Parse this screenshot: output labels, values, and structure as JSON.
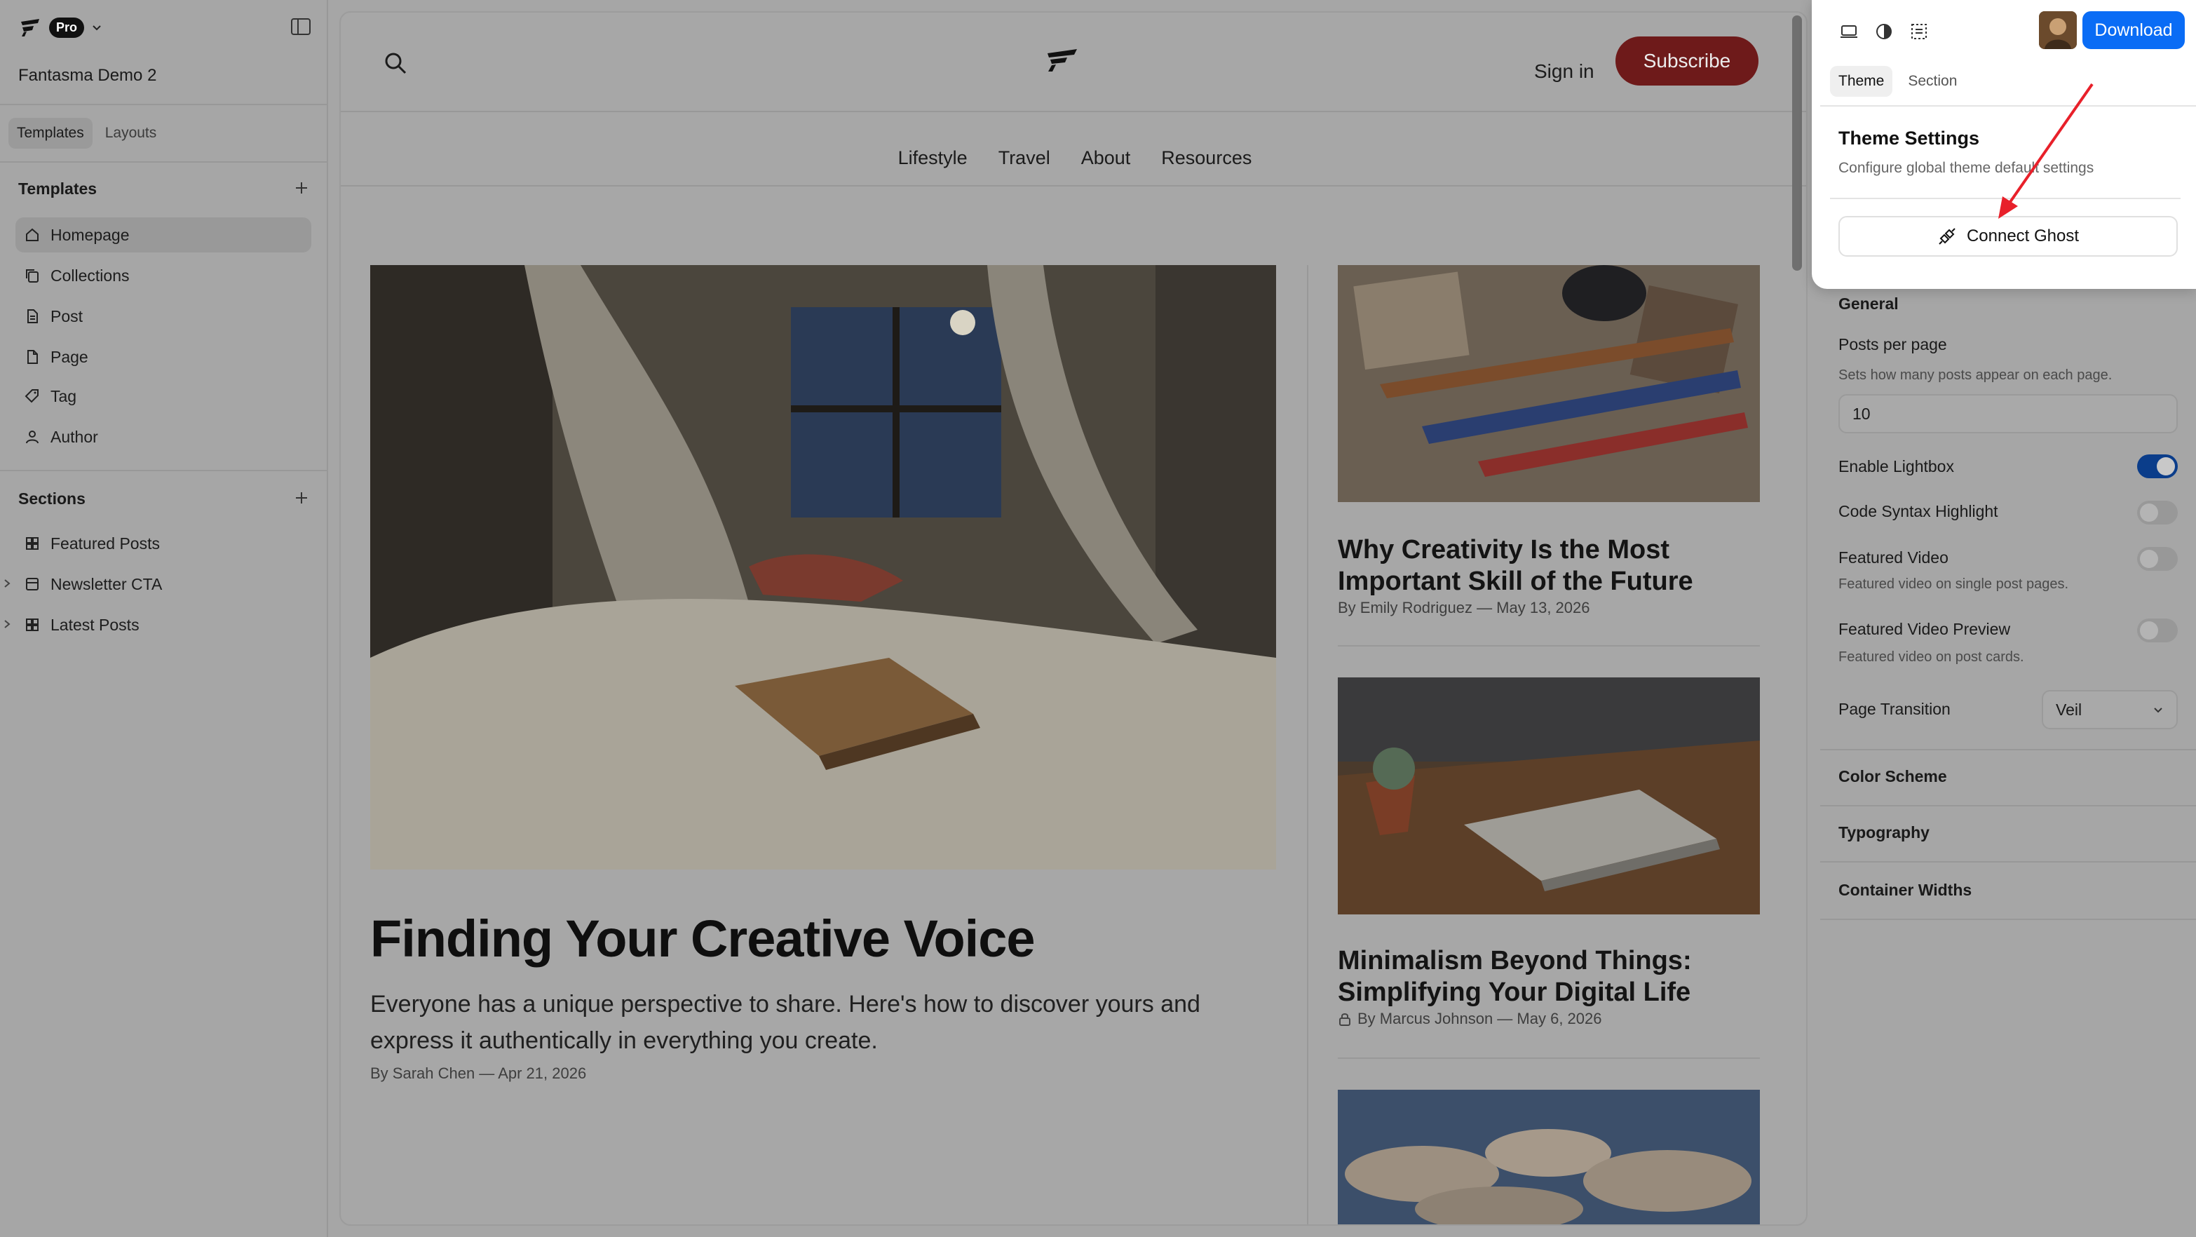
{
  "app": {
    "plan_badge": "Pro",
    "project_name": "Fantasma Demo 2",
    "mode_tabs": [
      "Templates",
      "Layouts"
    ],
    "active_mode": "Templates"
  },
  "sidebar": {
    "templates_heading": "Templates",
    "templates": [
      {
        "label": "Homepage",
        "icon": "home-icon",
        "active": true
      },
      {
        "label": "Collections",
        "icon": "copy-icon",
        "active": false
      },
      {
        "label": "Post",
        "icon": "document-icon",
        "active": false
      },
      {
        "label": "Page",
        "icon": "file-icon",
        "active": false
      },
      {
        "label": "Tag",
        "icon": "tag-icon",
        "active": false
      },
      {
        "label": "Author",
        "icon": "user-icon",
        "active": false
      }
    ],
    "sections_heading": "Sections",
    "sections": [
      {
        "label": "Featured Posts",
        "icon": "grid-icon",
        "expandable": false
      },
      {
        "label": "Newsletter CTA",
        "icon": "layout-icon",
        "expandable": true
      },
      {
        "label": "Latest Posts",
        "icon": "grid-icon",
        "expandable": true
      }
    ]
  },
  "canvas": {
    "sign_in": "Sign in",
    "subscribe": "Subscribe",
    "nav": [
      "Lifestyle",
      "Travel",
      "About",
      "Resources"
    ],
    "hero": {
      "title": "Finding Your Creative Voice",
      "excerpt": "Everyone has a unique perspective to share. Here's how to discover yours and express it authentically in everything you create.",
      "byline": "By Sarah Chen — Apr 21, 2026"
    },
    "cards": [
      {
        "title": "Why Creativity Is the Most Important Skill of the Future",
        "byline": "By Emily Rodriguez — May 13, 2026",
        "locked": false
      },
      {
        "title": "Minimalism Beyond Things: Simplifying Your Digital Life",
        "byline": "By Marcus Johnson — May 6, 2026",
        "locked": true
      }
    ]
  },
  "panel": {
    "download": "Download",
    "tabs": [
      "Theme",
      "Section"
    ],
    "active_tab": "Theme",
    "theme_settings_title": "Theme Settings",
    "theme_settings_sub": "Configure global theme default settings",
    "connect_ghost": "Connect Ghost",
    "general_heading": "General",
    "posts_per_page_label": "Posts per page",
    "posts_per_page_help": "Sets how many posts appear on each page.",
    "posts_per_page_value": "10",
    "enable_lightbox": "Enable Lightbox",
    "enable_lightbox_on": true,
    "code_syntax": "Code Syntax Highlight",
    "code_syntax_on": false,
    "featured_video": "Featured Video",
    "featured_video_help": "Featured video on single post pages.",
    "featured_video_on": false,
    "featured_video_preview": "Featured Video Preview",
    "featured_video_preview_help": "Featured video on post cards.",
    "featured_video_preview_on": false,
    "page_transition_label": "Page Transition",
    "page_transition_value": "Veil",
    "accordions": [
      "Color Scheme",
      "Typography",
      "Container Widths"
    ]
  },
  "colors": {
    "accent_blue": "#0a6cf5",
    "subscribe_red": "#c2272d",
    "annotation_arrow": "#e8202a"
  }
}
